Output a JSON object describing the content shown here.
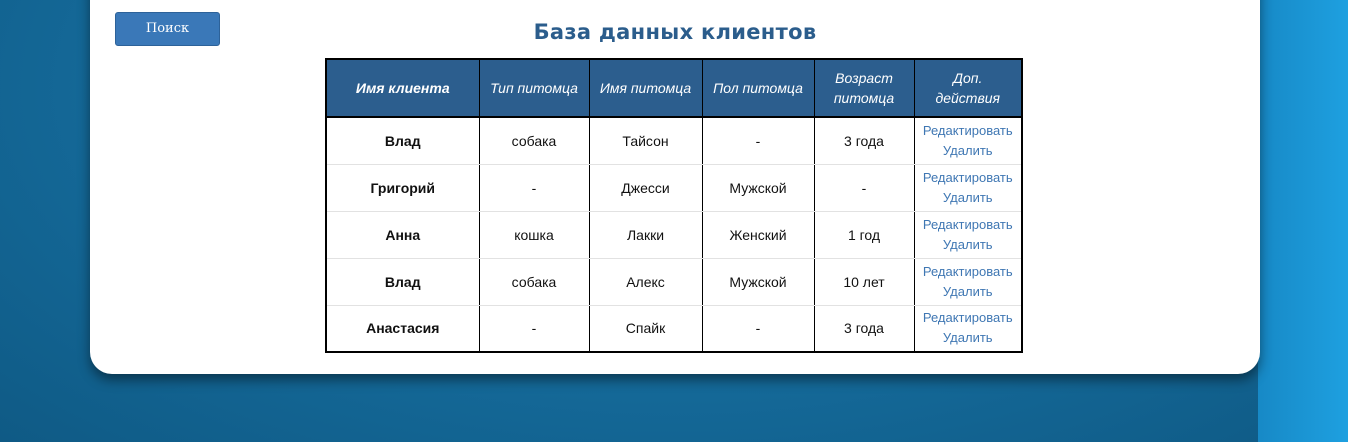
{
  "toolbar": {
    "search_label": "Поиск"
  },
  "page": {
    "title": "База данных клиентов"
  },
  "table": {
    "headers": [
      "Имя клиента",
      "Тип питомца",
      "Имя питомца",
      "Пол питомца",
      "Возраст питомца",
      "Доп. действия"
    ],
    "rows": [
      {
        "client": "Влад",
        "pet_type": "собака",
        "pet_name": "Тайсон",
        "pet_sex": "-",
        "pet_age": "3 года"
      },
      {
        "client": "Григорий",
        "pet_type": "-",
        "pet_name": "Джесси",
        "pet_sex": "Мужской",
        "pet_age": "-"
      },
      {
        "client": "Анна",
        "pet_type": "кошка",
        "pet_name": "Лакки",
        "pet_sex": "Женский",
        "pet_age": "1 год"
      },
      {
        "client": "Влад",
        "pet_type": "собака",
        "pet_name": "Алекс",
        "pet_sex": "Мужской",
        "pet_age": "10 лет"
      },
      {
        "client": "Анастасия",
        "pet_type": "-",
        "pet_name": "Спайк",
        "pet_sex": "-",
        "pet_age": "3 года"
      }
    ],
    "actions": {
      "edit": "Редактировать",
      "delete": "Удалить"
    }
  },
  "colors": {
    "header_bg": "#2c5e8e",
    "title": "#2b5d8c",
    "button": "#3a78b8",
    "link": "#3f77b3",
    "background": "#166e9f"
  }
}
